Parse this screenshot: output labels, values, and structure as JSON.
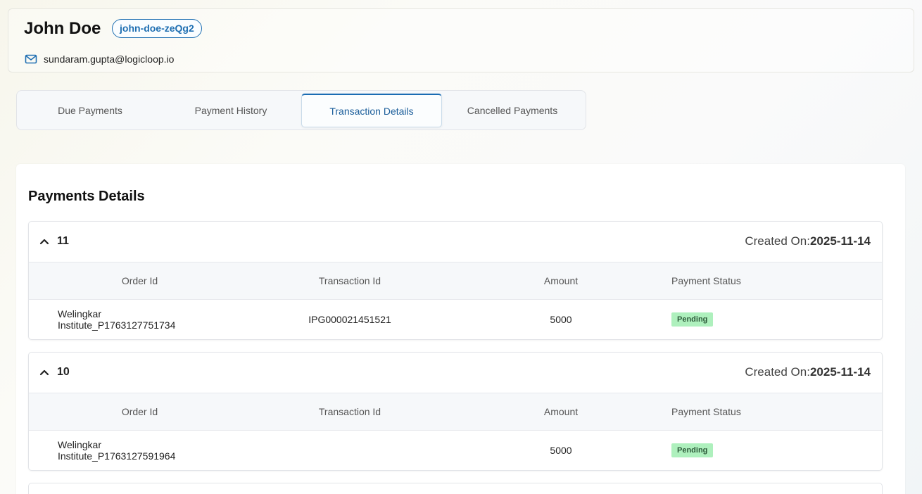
{
  "profile": {
    "name": "John Doe",
    "user_id": "john-doe-zeQg2",
    "email": "sundaram.gupta@logicloop.io"
  },
  "tabs": [
    {
      "label": "Due Payments",
      "active": false
    },
    {
      "label": "Payment History",
      "active": false
    },
    {
      "label": "Transaction Details",
      "active": true
    },
    {
      "label": "Cancelled Payments",
      "active": false
    }
  ],
  "section_title": "Payments Details",
  "table_headers": {
    "order_id": "Order Id",
    "transaction_id": "Transaction Id",
    "amount": "Amount",
    "payment_status": "Payment Status"
  },
  "created_on_label": "Created On:",
  "payments": [
    {
      "number": "11",
      "created_on": "2025-11-14",
      "rows": [
        {
          "order_id": "Welingkar Institute_P1763127751734",
          "transaction_id": "IPG000021451521",
          "amount": "5000",
          "status": "Pending"
        }
      ]
    },
    {
      "number": "10",
      "created_on": "2025-11-14",
      "rows": [
        {
          "order_id": "Welingkar Institute_P1763127591964",
          "transaction_id": "",
          "amount": "5000",
          "status": "Pending"
        }
      ]
    }
  ],
  "colors": {
    "accent": "#1a6cb3",
    "status_pending_bg": "#aef0bd",
    "status_pending_text": "#2d5a3a"
  },
  "icons": {
    "email": "mail-icon",
    "collapse": "chevron-up-icon"
  }
}
